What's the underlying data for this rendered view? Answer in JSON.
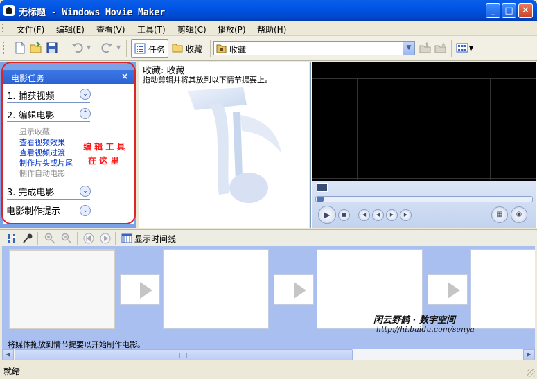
{
  "window": {
    "title": "无标题 - Windows Movie Maker",
    "minimize": "_",
    "maximize": "□",
    "close": "✕"
  },
  "menu": [
    "文件(F)",
    "编辑(E)",
    "查看(V)",
    "工具(T)",
    "剪辑(C)",
    "播放(P)",
    "帮助(H)"
  ],
  "toolbar": {
    "tasks_label": "任务",
    "collections_label": "收藏",
    "collection_value": "收藏",
    "dropdown_glyph": "▼"
  },
  "task_pane": {
    "header": "电影任务",
    "close_glyph": "×",
    "sections": [
      {
        "label": "1. 捕获视频",
        "chevron": "⌄"
      },
      {
        "label": "2. 编辑电影",
        "chevron": "⌃"
      },
      {
        "label": "3. 完成电影",
        "chevron": "⌄"
      },
      {
        "label": "电影制作提示",
        "chevron": "⌄"
      }
    ],
    "links": [
      {
        "label": "显示收藏",
        "enabled": false
      },
      {
        "label": "查看视频效果",
        "enabled": true
      },
      {
        "label": "查看视频过渡",
        "enabled": true
      },
      {
        "label": "制作片头或片尾",
        "enabled": true
      },
      {
        "label": "制作自动电影",
        "enabled": false
      }
    ],
    "annotation_line1": "编 辑 工 具",
    "annotation_line2": "在 这 里"
  },
  "collection": {
    "title": "收藏: 收藏",
    "hint": "拖动剪辑并将其放到以下情节提要上。"
  },
  "storyboard": {
    "show_timeline_label": "显示时间线",
    "hint": "将媒体拖放到情节提要以开始制作电影。",
    "watermark_name": "闲云野鹤 · 数字空间",
    "watermark_url": "http://hi.baidu.com/senya"
  },
  "status": {
    "text": "就绪"
  },
  "colors": {
    "title_bar": "#0055e5",
    "task_pane_bg": "#7ba2e7",
    "annotation_red": "#ff1a1a",
    "link_blue": "#0033cc",
    "disabled_gray": "#8c8c8c"
  }
}
